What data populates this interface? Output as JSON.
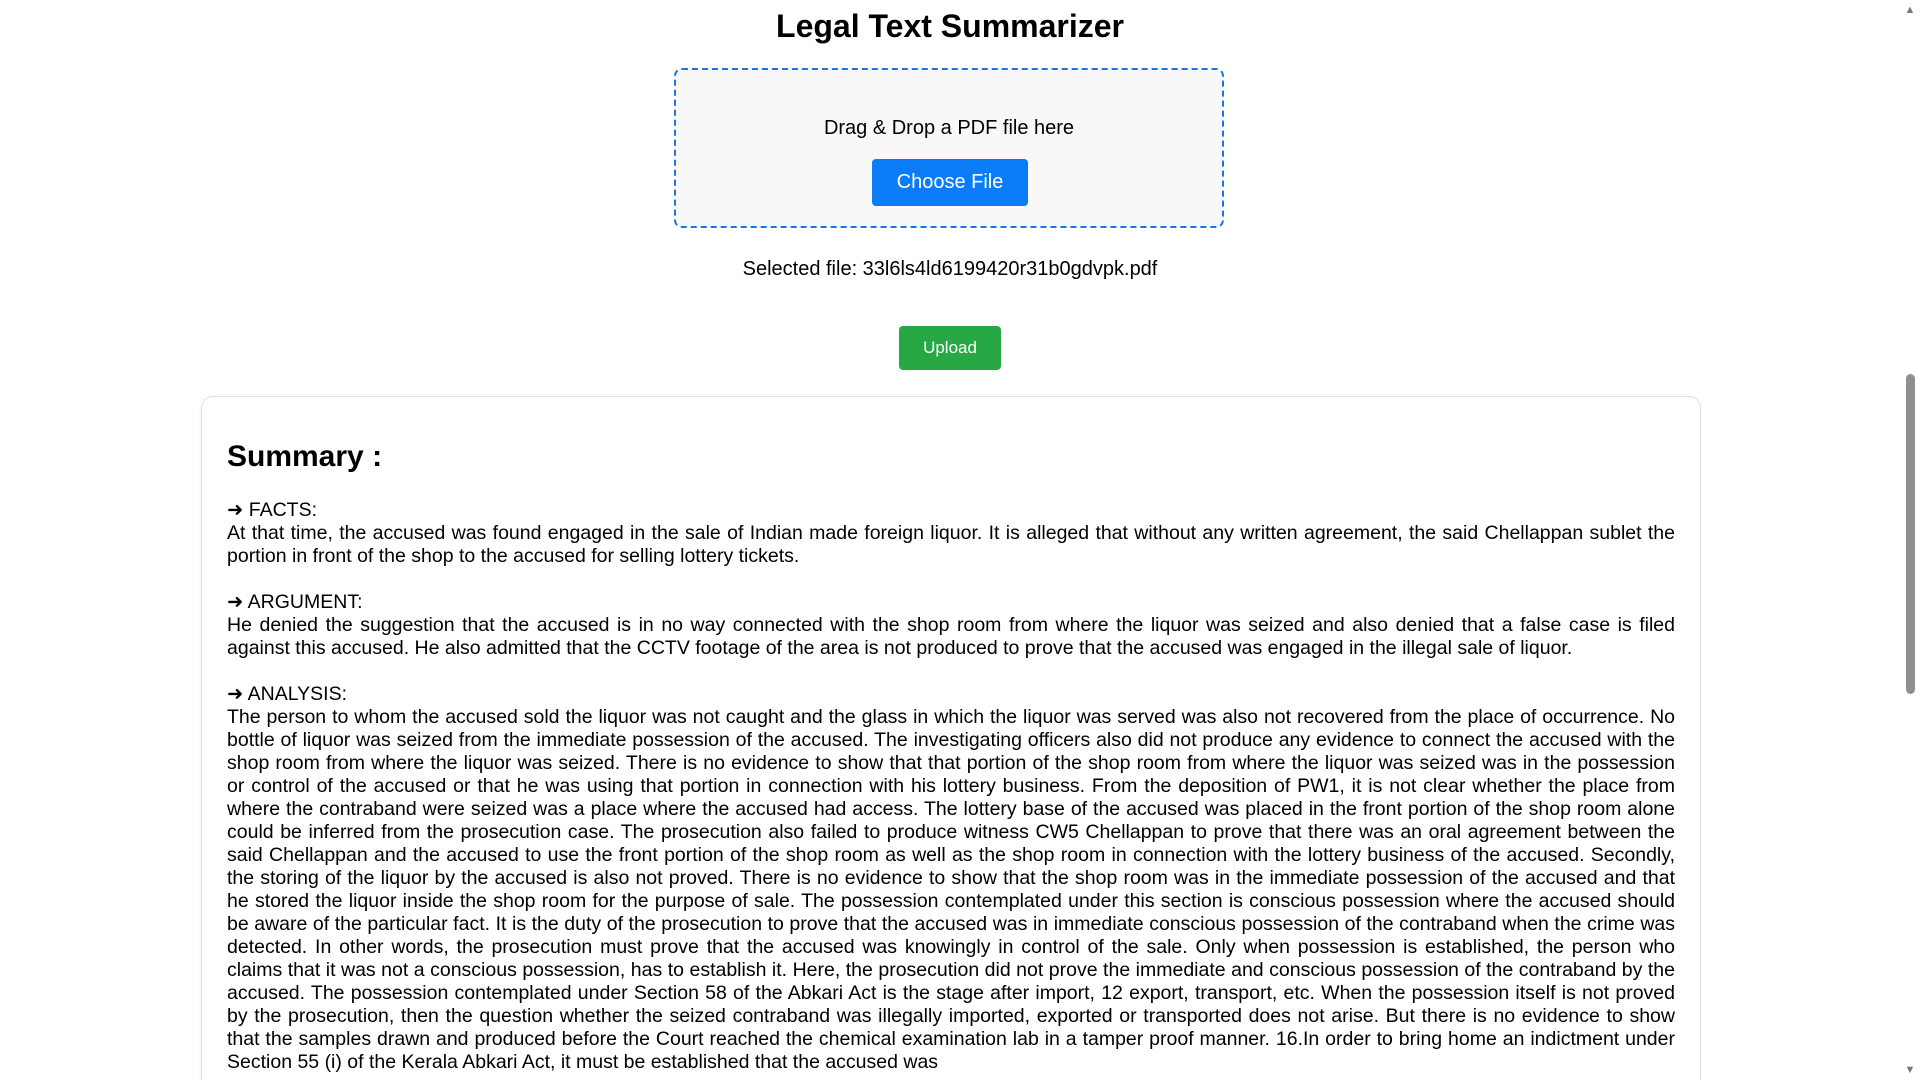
{
  "app": {
    "title": "Legal Text Summarizer"
  },
  "upload": {
    "dropzone_text": "Drag & Drop a PDF file here",
    "choose_label": "Choose File",
    "selected_file": "Selected file: 33l6ls4ld6199420r31b0gdvpk.pdf",
    "upload_label": "Upload"
  },
  "summary": {
    "heading": "Summary :",
    "sections": [
      {
        "label": "➜ FACTS:",
        "text": "At that time, the accused was found engaged in the sale of Indian made foreign liquor. It is alleged that without any written agreement, the said Chellappan sublet the portion in front of the shop to the accused for selling lottery tickets."
      },
      {
        "label": "➜ ARGUMENT:",
        "text": "He denied the suggestion that the accused is in no way connected with the shop room from where the liquor was seized and also denied that a false case is filed against this accused. He also admitted that the CCTV footage of the area is not produced to prove that the accused was engaged in the illegal sale of liquor."
      },
      {
        "label": "➜ ANALYSIS:",
        "text": "The person to whom the accused sold the liquor was not caught and the glass in which the liquor was served was also not recovered from the place of occurrence. No bottle of liquor was seized from the immediate possession of the accused. The investigating officers also did not produce any evidence to connect the accused with the shop room from where the liquor was seized. There is no evidence to show that that portion of the shop room from where the liquor was seized was in the possession or control of the accused or that he was using that portion in connection with his lottery business. From the deposition of PW1, it is not clear whether the place from where the contraband were seized was a place where the accused had access. The lottery base of the accused was placed in the front portion of the shop room alone could be inferred from the prosecution case. The prosecution also failed to produce witness CW5 Chellappan to prove that there was an oral agreement between the said Chellappan and the accused to use the front portion of the shop room as well as the shop room in connection with the lottery business of the accused. Secondly, the storing of the liquor by the accused is also not proved. There is no evidence to show that the shop room was in the immediate possession of the accused and that he stored the liquor inside the shop room for the purpose of sale. The possession contemplated under this section is conscious possession where the accused should be aware of the particular fact. It is the duty of the prosecution to prove that the accused was in immediate conscious possession of the contraband when the crime was detected. In other words, the prosecution must prove that the accused was knowingly in control of the sale. Only when possession is established, the person who claims that it was not a conscious possession, has to establish it. Here, the prosecution did not prove the immediate and conscious possession of the contraband by the accused. The possession contemplated under Section 58 of the Abkari Act is the stage after import, 12 export, transport, etc. When the possession itself is not proved by the prosecution, then the question whether the seized contraband was illegally imported, exported or transported does not arise. But there is no evidence to show that the samples drawn and produced before the Court reached the chemical examination lab in a tamper proof manner. 16.In order to bring home an indictment under Section 55 (i) of the Kerala Abkari Act, it must be established that the accused was"
      }
    ]
  },
  "scrollbar": {
    "up_icon": "▲",
    "down_icon": "▼"
  }
}
